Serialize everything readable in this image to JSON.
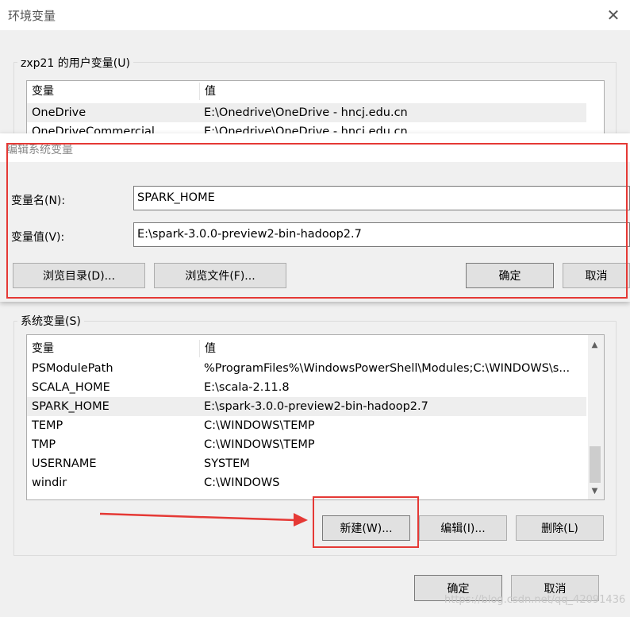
{
  "window": {
    "title": "环境变量",
    "close_symbol": "✕"
  },
  "user_vars": {
    "group_label": "zxp21 的用户变量(U)",
    "col_var": "变量",
    "col_val": "值",
    "rows": [
      {
        "name": "OneDrive",
        "value": "E:\\Onedrive\\OneDrive - hncj.edu.cn"
      },
      {
        "name": "OneDriveCommercial",
        "value": "E:\\Onedrive\\OneDrive - hncj.edu.cn"
      }
    ]
  },
  "edit_dialog": {
    "title": "编辑系统变量",
    "name_label": "变量名(N):",
    "name_value": "SPARK_HOME",
    "value_label": "变量值(V):",
    "value_value": "E:\\spark-3.0.0-preview2-bin-hadoop2.7",
    "browse_dir_label": "浏览目录(D)...",
    "browse_file_label": "浏览文件(F)...",
    "ok_label": "确定",
    "cancel_label": "取消"
  },
  "system_vars": {
    "group_label": "系统变量(S)",
    "col_var": "变量",
    "col_val": "值",
    "rows": [
      {
        "name": "PSModulePath",
        "value": "%ProgramFiles%\\WindowsPowerShell\\Modules;C:\\WINDOWS\\s..."
      },
      {
        "name": "SCALA_HOME",
        "value": "E:\\scala-2.11.8"
      },
      {
        "name": "SPARK_HOME",
        "value": "E:\\spark-3.0.0-preview2-bin-hadoop2.7"
      },
      {
        "name": "TEMP",
        "value": "C:\\WINDOWS\\TEMP"
      },
      {
        "name": "TMP",
        "value": "C:\\WINDOWS\\TEMP"
      },
      {
        "name": "USERNAME",
        "value": "SYSTEM"
      },
      {
        "name": "windir",
        "value": "C:\\WINDOWS"
      }
    ],
    "selected_row": "SPARK_HOME",
    "new_label": "新建(W)...",
    "edit_label": "编辑(I)...",
    "delete_label": "删除(L)"
  },
  "footer": {
    "ok_label": "确定",
    "cancel_label": "取消"
  },
  "watermark": "https://blog.csdn.net/qq_42091436",
  "colors": {
    "highlight": "#e53935",
    "arrow": "#e53935"
  },
  "icons": {
    "close": "close-icon",
    "scroll_up": "chevron-up-icon",
    "scroll_down": "chevron-down-icon",
    "annotation_arrow": "arrow-right-icon"
  }
}
